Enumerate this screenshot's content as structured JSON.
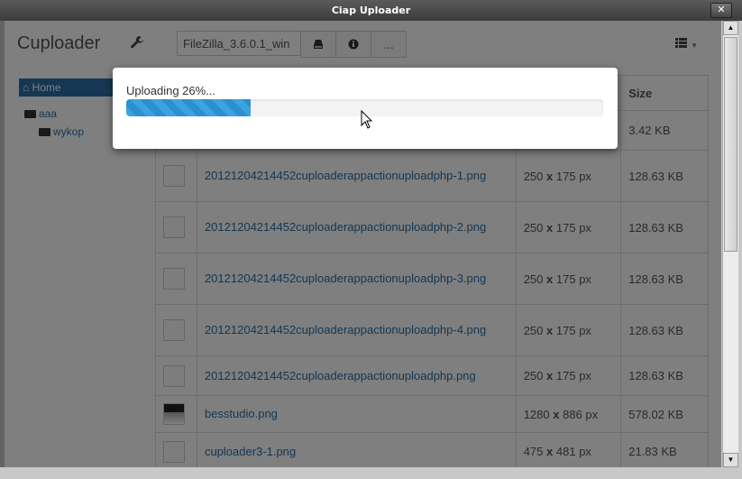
{
  "window": {
    "title": "Ciap Uploader",
    "close_label": "✕"
  },
  "header": {
    "brand": "Cuploader",
    "file_input_value": "FileZilla_3.6.0.1_win",
    "more_label": "...",
    "view_icon": "list-icon"
  },
  "sidebar": {
    "home_label": "Home",
    "folders": [
      {
        "label": "aaa"
      },
      {
        "label": "wykop"
      }
    ]
  },
  "table": {
    "headers": {
      "size": "Size"
    },
    "rows": [
      {
        "name": "",
        "dims": "",
        "size": "3.42 KB"
      },
      {
        "name": "20121204214452cuploaderappactionuploadphp-1.png",
        "dims_w": "250",
        "dims_h": "175 px",
        "size": "128.63 KB"
      },
      {
        "name": "20121204214452cuploaderappactionuploadphp-2.png",
        "dims_w": "250",
        "dims_h": "175 px",
        "size": "128.63 KB"
      },
      {
        "name": "20121204214452cuploaderappactionuploadphp-3.png",
        "dims_w": "250",
        "dims_h": "175 px",
        "size": "128.63 KB"
      },
      {
        "name": "20121204214452cuploaderappactionuploadphp-4.png",
        "dims_w": "250",
        "dims_h": "175 px",
        "size": "128.63 KB"
      },
      {
        "name": "20121204214452cuploaderappactionuploadphp.png",
        "dims_w": "250",
        "dims_h": "175 px",
        "size": "128.63 KB"
      },
      {
        "name": "besstudio.png",
        "dims_w": "1280",
        "dims_h": "886 px",
        "size": "578.02 KB"
      },
      {
        "name": "cuploader3-1.png",
        "dims_w": "475",
        "dims_h": "481 px",
        "size": "21.83 KB"
      }
    ]
  },
  "modal": {
    "message": "Uploading 26%...",
    "progress_percent": 26,
    "progress_color": "#3ba3e0"
  }
}
